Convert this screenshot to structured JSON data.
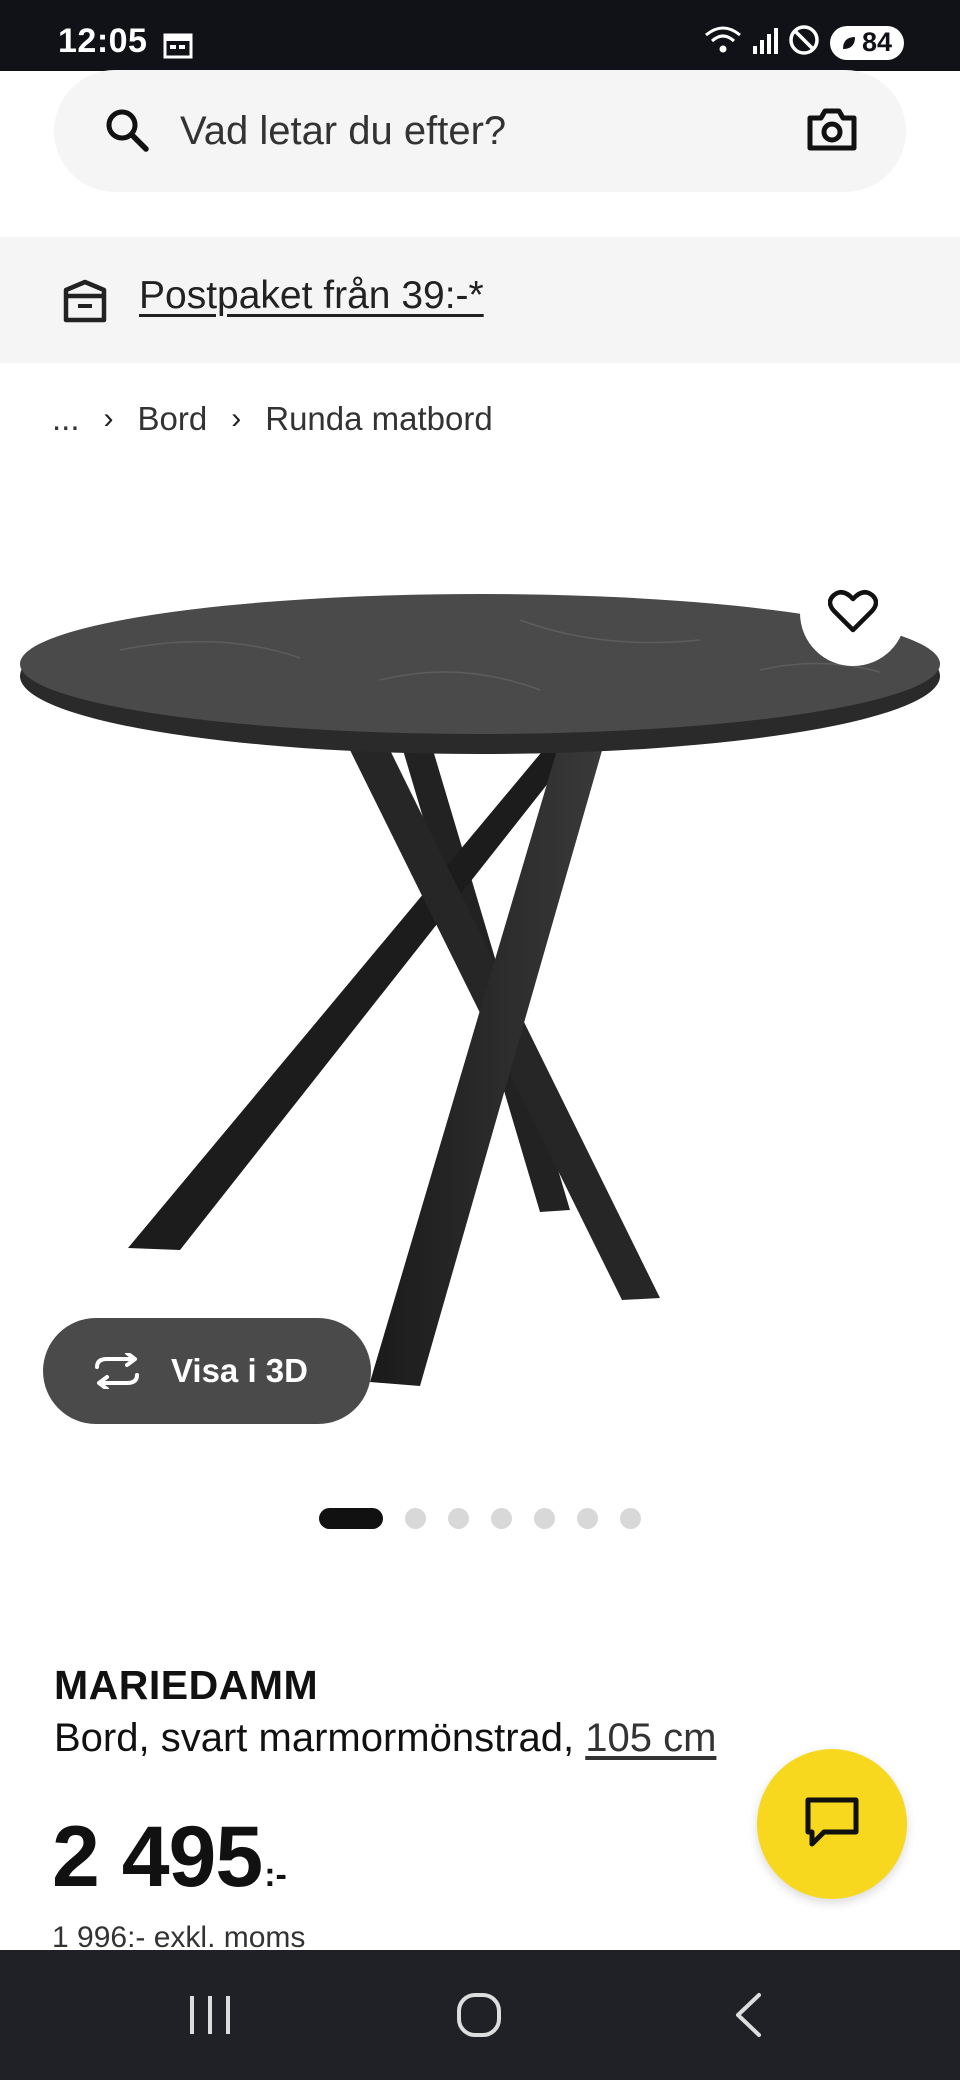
{
  "status_bar": {
    "time": "12:05",
    "battery": "84",
    "icons": [
      "calendar-icon",
      "wifi-icon",
      "signal-icon",
      "do-not-disturb-icon",
      "battery-icon"
    ]
  },
  "search": {
    "placeholder": "Vad letar du efter?",
    "value": ""
  },
  "promo": {
    "text": "Postpaket från 39:-*"
  },
  "breadcrumb": {
    "ellipsis": "...",
    "items": [
      "Bord",
      "Runda matbord"
    ]
  },
  "gallery": {
    "view_3d_label": "Visa i 3D",
    "image_count": 7,
    "active_index": 0
  },
  "product": {
    "name": "MARIEDAMM",
    "description": "Bord, svart marmormönstrad, ",
    "size_link": "105 cm",
    "price": "2 495",
    "price_suffix": ":-",
    "price_ex_vat": "1 996:- exkl. moms"
  },
  "colors": {
    "accent_yellow": "#f8d81e",
    "dark": "#111111",
    "surface": "#f5f5f5"
  }
}
